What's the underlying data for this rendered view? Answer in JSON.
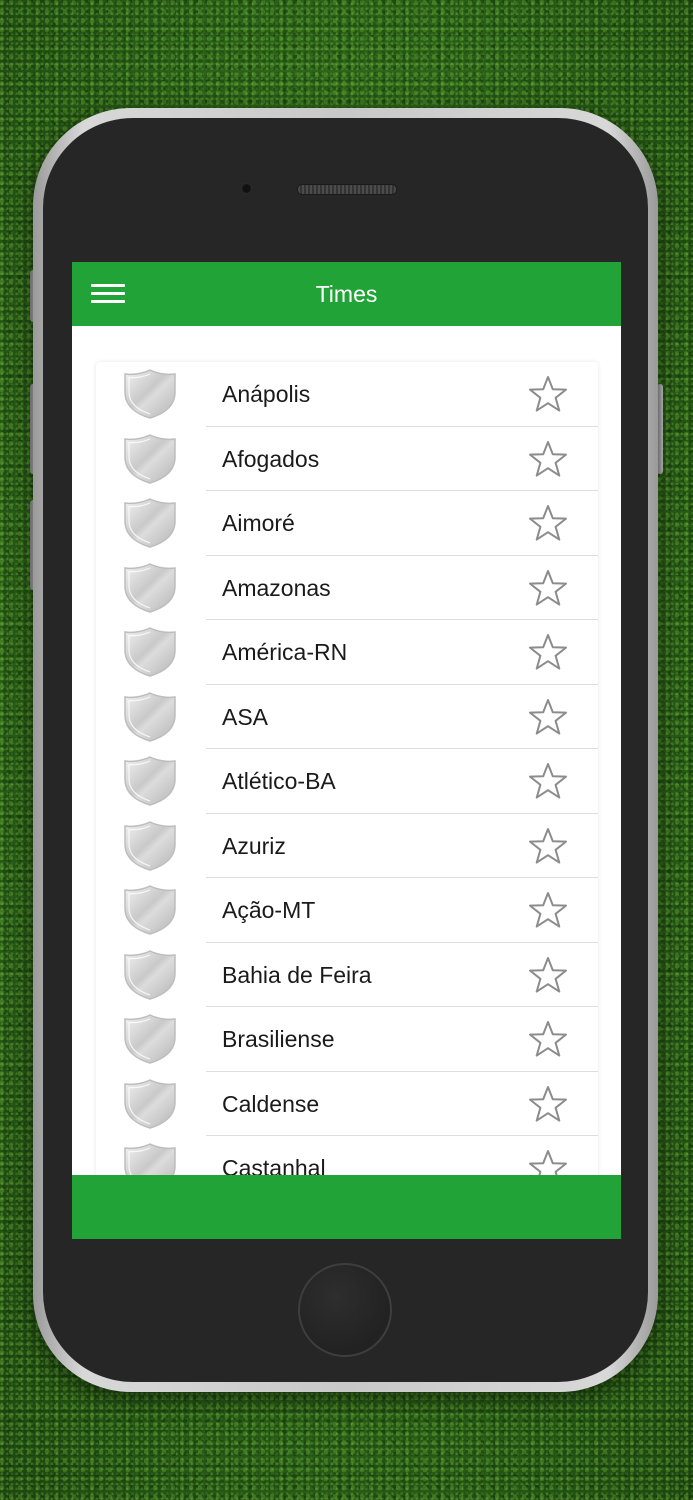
{
  "header": {
    "title": "Times",
    "menu_icon": "hamburger-menu-icon"
  },
  "teams": [
    {
      "name": "Anápolis"
    },
    {
      "name": "Afogados"
    },
    {
      "name": "Aimoré"
    },
    {
      "name": "Amazonas"
    },
    {
      "name": "América-RN"
    },
    {
      "name": "ASA"
    },
    {
      "name": "Atlético-BA"
    },
    {
      "name": "Azuriz"
    },
    {
      "name": "Ação-MT"
    },
    {
      "name": "Bahia de Feira"
    },
    {
      "name": "Brasiliense"
    },
    {
      "name": "Caldense"
    },
    {
      "name": "Castanhal"
    }
  ],
  "icons": {
    "team_crest": "shield-icon",
    "favorite": "star-outline-icon"
  },
  "colors": {
    "accent": "#21a338",
    "background": "#ffffff",
    "text": "#1a1a1a",
    "star_outline": "#8c8c8c",
    "crest": "#d4d4d4"
  }
}
